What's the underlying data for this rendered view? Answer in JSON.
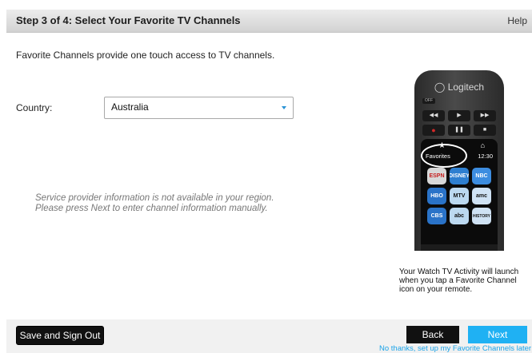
{
  "header": {
    "title": "Step 3 of 4: Select Your Favorite TV Channels",
    "help": "Help"
  },
  "intro": "Favorite Channels provide one touch access to TV channels.",
  "country": {
    "label": "Country:",
    "value": "Australia"
  },
  "provider_note": {
    "line1": "Service provider information is not available in your region.",
    "line2": "Please press Next to enter channel information manually."
  },
  "remote": {
    "brand": "Logitech",
    "off_label": "OFF",
    "favorites_label": "Favorites",
    "time": "12:30",
    "tiles": [
      "ESPN",
      "DISNEY",
      "NBC",
      "HBO",
      "MTV",
      "amc",
      "CBS",
      "abc",
      "HISTORY"
    ]
  },
  "caption": {
    "line1": "Your Watch TV Activity will launch",
    "line2": "when you tap a Favorite Channel",
    "line3": "icon on your remote."
  },
  "footer": {
    "save_label": "Save and Sign Out",
    "back_label": "Back",
    "next_label": "Next",
    "later_label": "No thanks, set up my Favorite Channels later"
  },
  "colors": {
    "accent": "#1fb1f3",
    "header_bg": "#dedede",
    "text": "#222222",
    "note": "#777777"
  }
}
